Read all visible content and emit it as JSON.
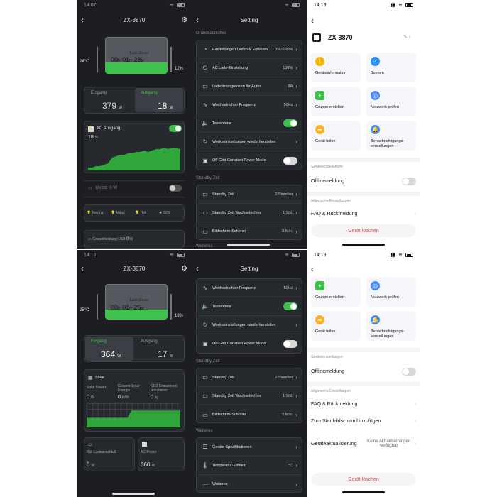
{
  "time": {
    "p1": "14:07",
    "p2": "",
    "p3": "14:13",
    "p4": "14:12",
    "p6": "14:13"
  },
  "device": {
    "name": "ZX-3870"
  },
  "p1": {
    "charge_label": "Lade-Dauer",
    "charge_days": "00",
    "charge_hours": "01",
    "charge_minutes": "28",
    "unit_d": "D",
    "unit_h": "H",
    "unit_m": "M",
    "temp": "24°C",
    "battery_pct": "12%",
    "input_label": "Eingang",
    "input_value": "379",
    "input_unit": "W",
    "output_label": "Ausgang",
    "output_value": "18",
    "output_unit": "W",
    "ac_label": "AC Ausgang",
    "ac_value": "18",
    "ac_unit": "W",
    "dc_label": "12V DC",
    "dc_value": "0 W",
    "light_low": "Niedrig",
    "light_mid": "Mittel",
    "light_high": "Hell",
    "light_sos": "SOS",
    "usb_label": "Gesamtleistung USB",
    "usb_value": "0",
    "usb_unit": "W"
  },
  "p4": {
    "charge_label": "Lade-Dauer",
    "charge_days": "00",
    "charge_hours": "01",
    "charge_minutes": "26",
    "unit_d": "D",
    "unit_h": "H",
    "unit_m": "M",
    "temp": "25°C",
    "battery_pct": "18%",
    "input_label": "Eingang",
    "input_value": "364",
    "input_unit": "W",
    "output_label": "Ausgang",
    "output_value": "17",
    "output_unit": "W",
    "solar_label": "Solar",
    "solar_power_label": "Solar Power",
    "solar_energy_label": "Gesamt Solar-Energie",
    "co2_label": "CO2 Emissionen reduzieren",
    "solar_power_value": "0",
    "solar_power_unit": "W",
    "solar_energy_value": "0",
    "solar_energy_unit": "kWh",
    "co2_value": "0",
    "co2_unit": "kg",
    "car_label": "Kfz.-Ladeanschluß",
    "car_value": "0",
    "car_unit": "W",
    "ac_power_label": "AC Power",
    "ac_power_value": "360",
    "ac_power_unit": "W"
  },
  "settings": {
    "title": "Setting",
    "sec1": "Grundsätzliches",
    "sec2": "Standby Zeit",
    "sec3": "Weiteres",
    "charge_limits": "Einstellungen Laden & Entladen",
    "charge_limits_val": "0%~100%",
    "ac_charge": "AC Lade-Einstellung",
    "ac_charge_val": "100%",
    "car_limit": "Ladestromgrenzen für Autos",
    "car_limit_val": "8A",
    "inverter_freq": "Wechselrichter Frequenz",
    "inverter_freq_val": "50Hz",
    "keytones": "Tastentöne",
    "factory_reset": "Werkseinstellungen wiederherstellen",
    "offgrid": "Off-Grid Constant Power Mode",
    "standby": "Standby Zeit",
    "standby_val": "2 Stunden",
    "standby_inv": "Standby Zeit Wechselrichter",
    "standby_inv_val": "1 Std.",
    "screensaver": "Bildschirm-Schoner",
    "screensaver_val": "5 Min.",
    "specs": "Geräte Spezifikationen",
    "temp_unit": "Temperatur-Einheit",
    "temp_unit_val": "°C",
    "more": "Weiteres",
    "section_more": "Weiteres"
  },
  "light": {
    "device_info": "Geräteinformation",
    "scenes": "Szenen",
    "create_group": "Gruppe erstellen",
    "check_network": "Netzwerk prüfen",
    "share": "Gerät teilen",
    "notif": "Benachrichtigungs-einstellungen",
    "dev_settings": "Geräteeinstellungen",
    "offline": "Offlinemeldung",
    "general": "Allgemeine Einstellungen",
    "faq": "FAQ & Rückmeldung",
    "add_home": "Zum Startbildschirm hinzufügen",
    "fw_update": "Geräteaktualisierung",
    "fw_status": "Keine Aktualisierungen verfügbar",
    "delete": "Gerät löschen"
  },
  "colors": {
    "accent_green": "#3dbf4a",
    "dark_bg": "#1c1e22",
    "card": "#26292e",
    "delete_red": "#e0474c"
  },
  "chart_ac": [
    2,
    2,
    3,
    3,
    4,
    5,
    9,
    10,
    11,
    11,
    12,
    12,
    13,
    13,
    14,
    13,
    14,
    15,
    15,
    16,
    15,
    16,
    16,
    15
  ],
  "chart_solar": [
    4,
    4,
    4,
    4,
    4,
    4,
    4,
    4,
    4,
    4,
    4,
    7,
    7,
    7,
    7,
    7,
    7,
    7,
    7,
    7,
    7,
    7,
    7,
    7
  ]
}
